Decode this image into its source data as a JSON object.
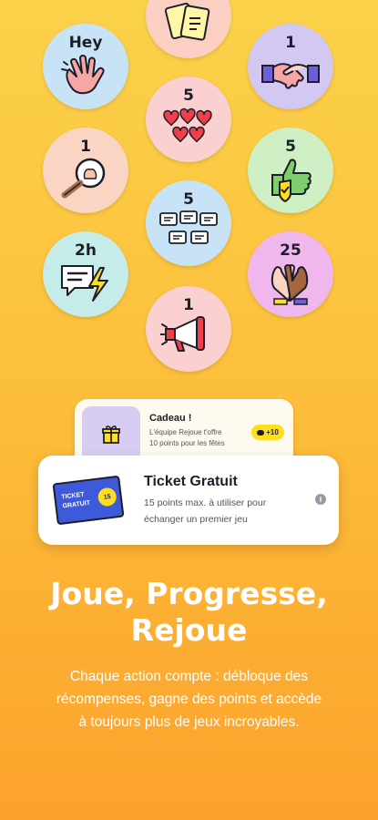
{
  "colors": {
    "background_top": "#fbd24a",
    "background_bottom": "#fca22c",
    "text_dark": "#1e1e2a",
    "ticket_blue": "#3d5bd9",
    "ticket_yellow": "#ffdd1f"
  },
  "badges": [
    {
      "id": "gift-cards",
      "label": "",
      "icon": "gift-cards-icon",
      "color": "#fbcfc2"
    },
    {
      "id": "hey",
      "label": "Hey",
      "icon": "waving-hand-icon",
      "color": "#c9e3f6"
    },
    {
      "id": "handshake",
      "label": "1",
      "icon": "handshake-icon",
      "color": "#d2c8f1"
    },
    {
      "id": "hearts",
      "label": "5",
      "icon": "hearts-icon",
      "color": "#fbd0d1"
    },
    {
      "id": "magnifier",
      "label": "1",
      "icon": "magnifier-icon",
      "color": "#fad5c3"
    },
    {
      "id": "thumbs-up",
      "label": "5",
      "icon": "thumbs-up-icon",
      "color": "#cfefc4"
    },
    {
      "id": "messages",
      "label": "5",
      "icon": "message-bubbles-icon",
      "color": "#c9e3f6"
    },
    {
      "id": "fast-reply",
      "label": "2h",
      "icon": "chat-lightning-icon",
      "color": "#c6ecea"
    },
    {
      "id": "high-five",
      "label": "25",
      "icon": "high-five-icon",
      "color": "#efb7ec"
    },
    {
      "id": "megaphone",
      "label": "1",
      "icon": "megaphone-icon",
      "color": "#fbd0d1"
    }
  ],
  "gift_card": {
    "title": "Cadeau !",
    "text_line1": "L'équipe Rejoue t'offre",
    "text_line2": "10 points pour les fêtes",
    "points": "+10",
    "icon": "gift-box-icon"
  },
  "ticket_card": {
    "title": "Ticket Gratuit",
    "text_line1": "15 points max. à utiliser pour",
    "text_line2": "échanger un premier jeu",
    "ticket_line1": "TICKET",
    "ticket_line2": "GRATUIT",
    "ticket_badge": "15",
    "info_icon": "info-icon"
  },
  "headline": {
    "line1": "Joue, Progresse,",
    "line2": "Rejoue"
  },
  "subtitle": {
    "line1": "Chaque action compte : débloque des",
    "line2": "récompenses, gagne des points et accède",
    "line3": "à toujours plus de jeux incroyables."
  }
}
